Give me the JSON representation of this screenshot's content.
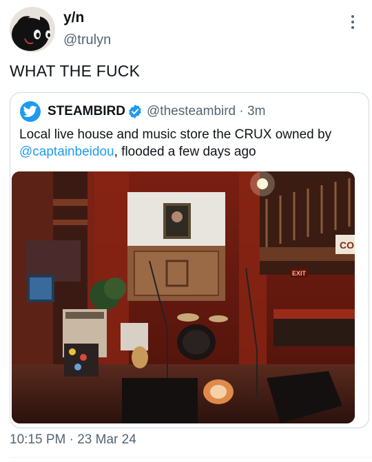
{
  "author": {
    "display_name": "y/n",
    "handle": "@trulyn"
  },
  "tweet": {
    "text": "WHAT THE FUCK",
    "time": "10:15 PM",
    "date": "23 Mar 24"
  },
  "quoted": {
    "name": "STEAMBIRD",
    "handle": "@thesteambird",
    "age": "3m",
    "text_before": "Local live house and music store the CRUX owned by",
    "mention": "@captainbeidou",
    "text_after": ", flooded a few days ago",
    "image_signs": {
      "exit": "EXIT",
      "side_banner": "CO"
    }
  },
  "icons": {
    "more": "more-vertical-icon",
    "verified": "verified-badge-icon",
    "bird": "bird-logo-icon"
  },
  "colors": {
    "accent": "#1d9bf0",
    "secondary_text": "#536471",
    "border": "#cfd9de"
  }
}
